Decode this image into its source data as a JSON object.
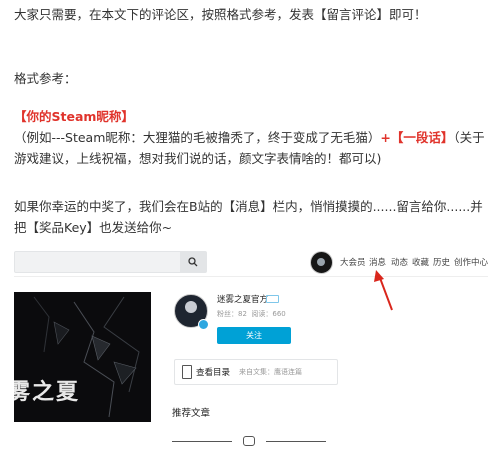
{
  "article": {
    "line1": "大家只需要，在本文下的评论区，按照格式参考，发表【留言评论】即可！",
    "format_label": "格式参考：",
    "format_steam_tag": "【你的Steam昵称】",
    "format_example": "（例如---Steam昵称：大狸猫的毛被撸秃了，终于变成了无毛猫）",
    "format_plus": "+",
    "format_message_tag": "【一段话】",
    "format_message_desc": "（关于游戏建议，上线祝福，想对我们说的话，颜文字表情啥的！都可以)",
    "prize_line": "如果你幸运的中奖了，我们会在B站的【消息】栏内，悄悄摸摸的......留言给你......并把【奖品Key】也发送给你~"
  },
  "screenshot": {
    "nav": {
      "items": [
        "大会员",
        "消息",
        "动态",
        "收藏",
        "历史",
        "创作中心"
      ]
    },
    "cover": {
      "title": "雾之夏"
    },
    "author": {
      "name": "迷雾之夏官方",
      "fans_label": "粉丝：82",
      "reads_label": "阅读：660",
      "follow_label": "关注"
    },
    "directory": {
      "label": "查看目录",
      "collection": "来自文集：鹰语连篇"
    },
    "recommend_title": "推荐文章",
    "colors": {
      "accent": "#00a1d6",
      "highlight_red": "#e0332b",
      "arrow_red": "#d9261c"
    }
  }
}
